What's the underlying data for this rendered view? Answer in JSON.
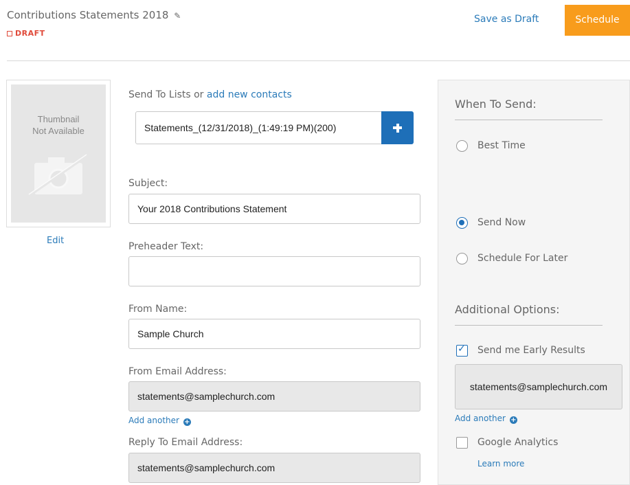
{
  "header": {
    "title": "Contributions Statements 2018",
    "edit_icon": "pencil-icon",
    "status": "DRAFT",
    "save_draft_label": "Save as Draft",
    "schedule_label": "Schedule"
  },
  "thumbnail": {
    "line1": "Thumbnail",
    "line2": "Not Available",
    "edit_label": "Edit"
  },
  "form": {
    "send_to_label": "Send To Lists or ",
    "add_contacts_link": "add new contacts",
    "list_value": "Statements_(12/31/2018)_(1:49:19 PM)(200)",
    "subject_label": "Subject:",
    "subject_value": "Your 2018 Contributions Statement",
    "preheader_label": "Preheader Text:",
    "preheader_value": "",
    "from_name_label": "From Name:",
    "from_name_value": "Sample Church",
    "from_email_label": "From Email Address:",
    "from_email_value": "statements@samplechurch.com",
    "add_another_label": "Add another",
    "reply_to_label": "Reply To Email Address:",
    "reply_to_value": "statements@samplechurch.com"
  },
  "when_to_send": {
    "heading": "When To Send:",
    "options": [
      {
        "label": "Best Time",
        "selected": false
      },
      {
        "label": "Send Now",
        "selected": true
      },
      {
        "label": "Schedule For Later",
        "selected": false
      }
    ]
  },
  "additional_options": {
    "heading": "Additional Options:",
    "early_results_label": "Send me Early Results",
    "early_results_checked": true,
    "early_results_email": "statements@samplechurch.com",
    "add_another_label": "Add another",
    "google_analytics_label": "Google Analytics",
    "google_analytics_checked": false,
    "learn_more_label": "Learn more"
  },
  "colors": {
    "accent": "#1e6fb8",
    "link": "#2b7bb9",
    "schedule": "#f89c1c",
    "draft": "#e04a3a"
  }
}
